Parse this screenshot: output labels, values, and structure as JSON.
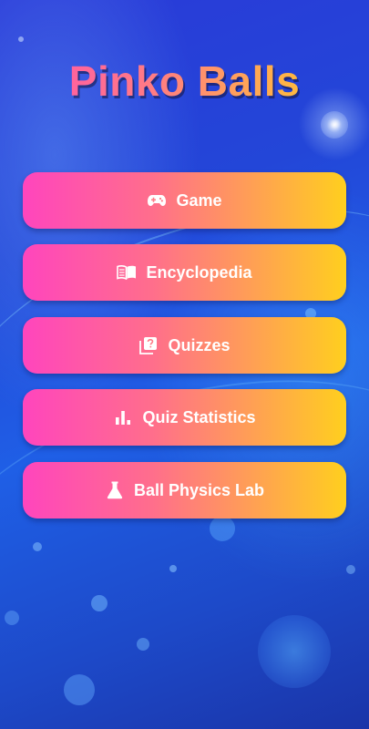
{
  "app": {
    "title": "Pinko Balls"
  },
  "menu": {
    "items": [
      {
        "label": "Game",
        "icon": "gamepad-icon"
      },
      {
        "label": "Encyclopedia",
        "icon": "book-icon"
      },
      {
        "label": "Quizzes",
        "icon": "quiz-icon"
      },
      {
        "label": "Quiz Statistics",
        "icon": "bar-chart-icon"
      },
      {
        "label": "Ball Physics Lab",
        "icon": "flask-icon"
      }
    ]
  },
  "colors": {
    "background": "#1f4fe0",
    "button_gradient_start": "#ff45bd",
    "button_gradient_end": "#ffcf1e",
    "title_gradient_start": "#ff4fb0",
    "title_gradient_end": "#ffd21f",
    "button_text": "#ffffff"
  }
}
